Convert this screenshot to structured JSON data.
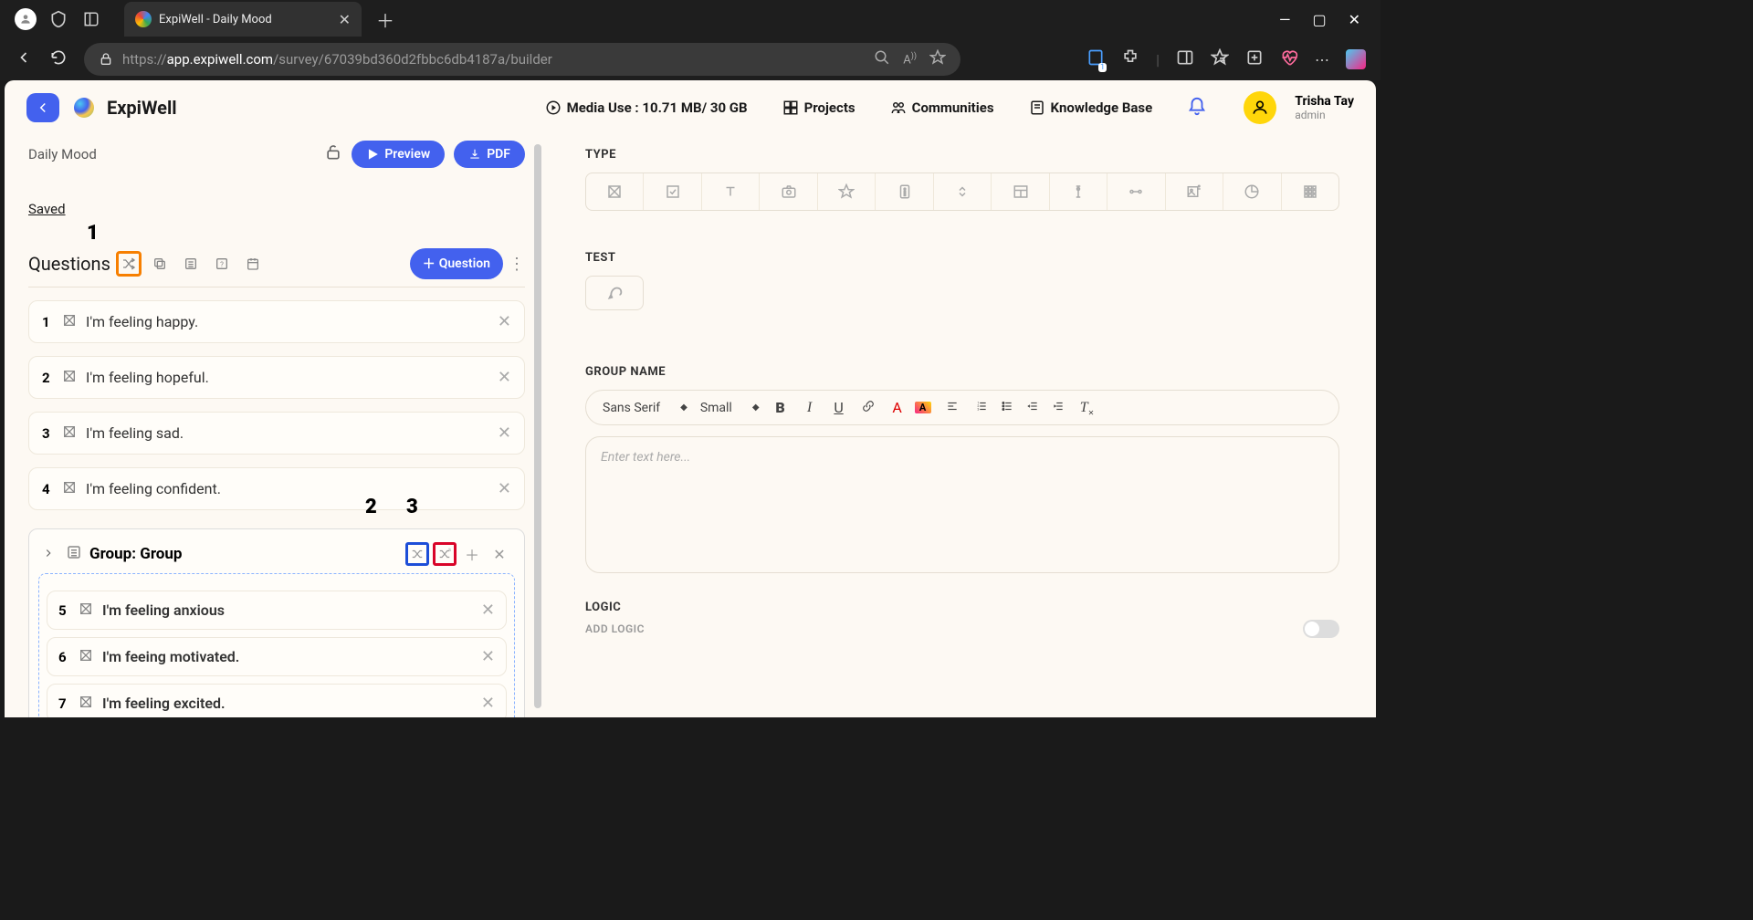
{
  "browser": {
    "tab_title": "ExpiWell - Daily Mood",
    "url_protocol": "https://",
    "url_host": "app.expiwell.com",
    "url_path": "/survey/67039bd360d2fbbc6db4187a/builder"
  },
  "header": {
    "brand": "ExpiWell",
    "media_use": "Media Use : 10.71 MB/ 30 GB",
    "nav": {
      "projects": "Projects",
      "communities": "Communities",
      "knowledge": "Knowledge Base"
    },
    "user": {
      "name": "Trisha Tay",
      "role": "admin"
    }
  },
  "left": {
    "survey_name": "Daily Mood",
    "preview": "Preview",
    "pdf": "PDF",
    "saved": "Saved",
    "questions_label": "Questions",
    "add_question": "Question",
    "annotations": {
      "a1": "1",
      "a2": "2",
      "a3": "3"
    },
    "questions": [
      {
        "num": "1",
        "text": "I'm feeling happy."
      },
      {
        "num": "2",
        "text": "I'm feeling hopeful."
      },
      {
        "num": "3",
        "text": "I'm feeling sad."
      },
      {
        "num": "4",
        "text": "I'm feeling confident."
      }
    ],
    "group": {
      "title": "Group: Group",
      "questions": [
        {
          "num": "5",
          "text": "I'm feeling anxious"
        },
        {
          "num": "6",
          "text": "I'm feeing motivated."
        },
        {
          "num": "7",
          "text": "I'm feeling excited."
        }
      ]
    }
  },
  "right": {
    "type": "TYPE",
    "test": "TEST",
    "group_name": "GROUP NAME",
    "editor": {
      "font": "Sans Serif",
      "size": "Small",
      "placeholder": "Enter text here..."
    },
    "logic": "LOGIC",
    "add_logic": "ADD LOGIC"
  }
}
